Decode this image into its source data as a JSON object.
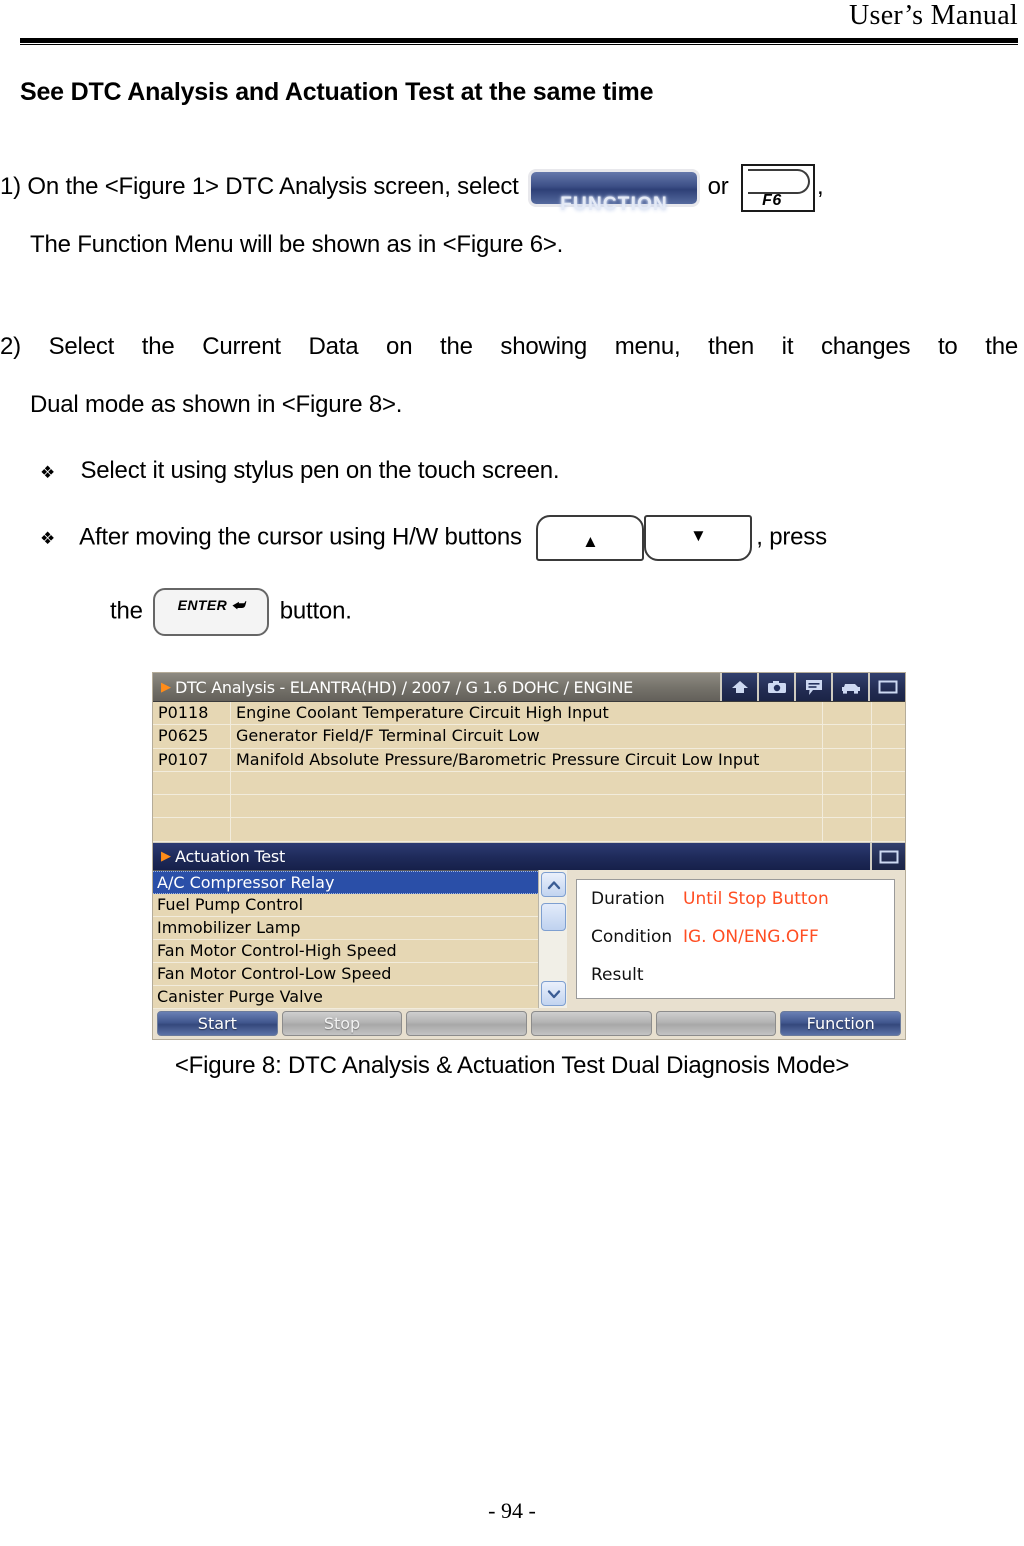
{
  "header": {
    "title": "User’s Manual"
  },
  "section": {
    "heading": "See DTC Analysis and Actuation Test at the same time"
  },
  "steps": {
    "step1_line1_before": "1)  On the <Figure 1> DTC Analysis screen, select",
    "step1_or": "or",
    "step1_comma": ",",
    "step1_line2": "The Function Menu will be shown as in <Figure 6>.",
    "step2_line1": "2)  Select the Current Data on the showing menu, then it changes to the",
    "step2_line2": "Dual mode as shown in <Figure 8>."
  },
  "bullets": {
    "marker": "❖",
    "b1": "Select it using stylus pen on the touch screen.",
    "b2_before": "After moving the cursor using H/W buttons",
    "b2_after": ", press",
    "b3_before": "the",
    "b3_after": "button."
  },
  "keys": {
    "function_label": "FUNCTION",
    "f6_label": "F6",
    "up_glyph": "▲",
    "down_glyph": "▼",
    "enter_label": "ENTER ⮨"
  },
  "figure": {
    "dtc_panel": {
      "title": "DTC Analysis - ELANTRA(HD) / 2007 / G 1.6 DOHC / ENGINE",
      "triangle": "▶",
      "icons": [
        "home-icon",
        "camera-icon",
        "comment-icon",
        "car-icon",
        "maximize-icon"
      ],
      "rows": [
        {
          "code": "P0118",
          "desc": "Engine Coolant Temperature Circuit High Input"
        },
        {
          "code": "P0625",
          "desc": "Generator Field/F Terminal Circuit Low"
        },
        {
          "code": "P0107",
          "desc": "Manifold Absolute Pressure/Barometric Pressure Circuit Low Input"
        },
        {
          "code": "",
          "desc": ""
        },
        {
          "code": "",
          "desc": ""
        },
        {
          "code": "",
          "desc": ""
        }
      ]
    },
    "act_panel": {
      "title": "Actuation Test",
      "triangle": "▶",
      "maximize_icon": "maximize-icon",
      "items": [
        "A/C Compressor Relay",
        "Fuel Pump Control",
        "Immobilizer Lamp",
        "Fan Motor Control-High Speed",
        "Fan Motor Control-Low Speed",
        "Canister Purge Valve"
      ],
      "selected_index": 0,
      "scroll_up_glyph": "⌃",
      "scroll_down_glyph": "⌄",
      "info": [
        {
          "key": "Duration",
          "value": "Until Stop Button",
          "color": "#ff4d22"
        },
        {
          "key": "Condition",
          "value": "IG. ON/ENG.OFF",
          "color": "#ff4d22"
        },
        {
          "key": "Result",
          "value": "",
          "color": "#000000"
        }
      ],
      "buttons": [
        {
          "label": "Start",
          "style": "blue"
        },
        {
          "label": "Stop",
          "style": "grey"
        },
        {
          "label": "",
          "style": "grey"
        },
        {
          "label": "",
          "style": "grey"
        },
        {
          "label": "",
          "style": "grey"
        },
        {
          "label": "Function",
          "style": "blue"
        }
      ]
    }
  },
  "caption": "<Figure 8: DTC Analysis & Actuation Test Dual Diagnosis Mode>",
  "footer": {
    "page": "- 94 -"
  }
}
